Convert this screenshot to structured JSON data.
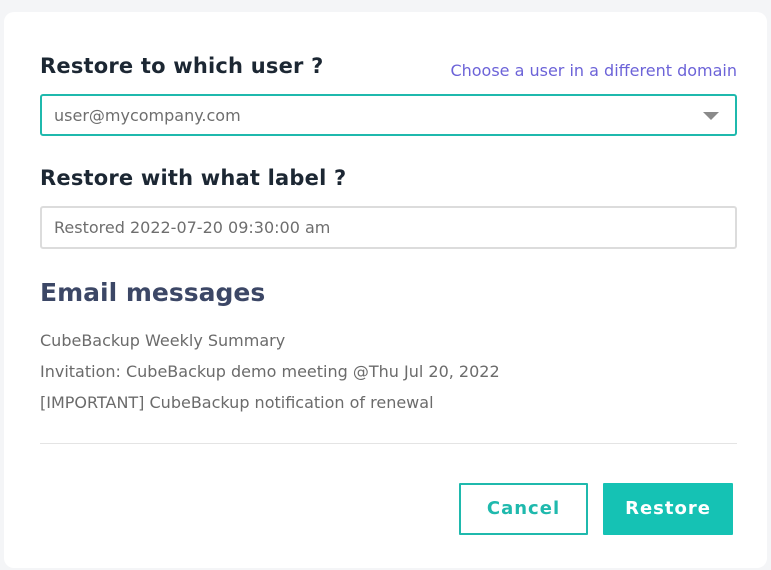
{
  "dialog": {
    "user_section": {
      "title": "Restore to which user ?",
      "link_text": "Choose a user in a different domain",
      "selected_user": "user@mycompany.com"
    },
    "label_section": {
      "title": "Restore with what label ?",
      "label_value": "Restored 2022-07-20 09:30:00 am"
    },
    "email_section": {
      "title": "Email messages",
      "messages": [
        "CubeBackup Weekly Summary",
        "Invitation: CubeBackup demo meeting @Thu Jul 20, 2022",
        "[IMPORTANT] CubeBackup notification of renewal"
      ]
    },
    "buttons": {
      "cancel": "Cancel",
      "restore": "Restore"
    }
  },
  "colors": {
    "accent": "#1fb9ad",
    "primary_button": "#15c2b4",
    "link": "#6c63d8",
    "heading": "#1c2733",
    "email_heading": "#3c4766"
  },
  "icons": {
    "dropdown": "chevron-down-icon"
  }
}
